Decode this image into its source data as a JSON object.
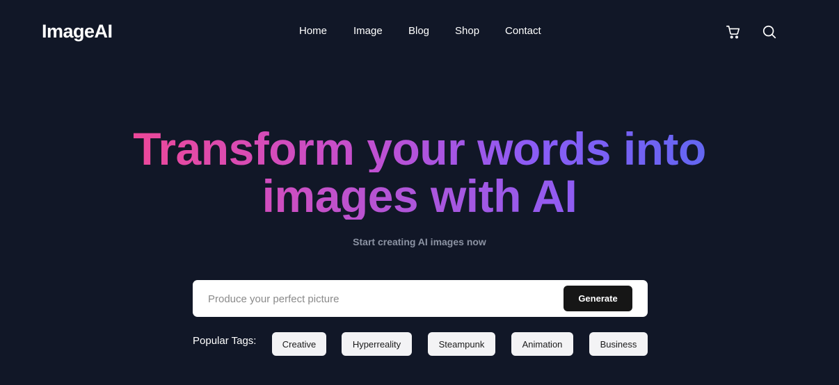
{
  "brand": {
    "name": "ImageAI"
  },
  "nav": {
    "items": [
      {
        "label": "Home"
      },
      {
        "label": "Image"
      },
      {
        "label": "Blog"
      },
      {
        "label": "Shop"
      },
      {
        "label": "Contact"
      }
    ]
  },
  "header_icons": {
    "cart": "cart-icon",
    "search": "search-icon"
  },
  "hero": {
    "title_line1": "Transform your words into",
    "title_line2": "images with AI",
    "subtitle": "Start creating AI images now"
  },
  "prompt": {
    "placeholder": "Produce your perfect picture",
    "value": "",
    "button_label": "Generate"
  },
  "tags": {
    "label": "Popular Tags:",
    "items": [
      {
        "label": "Creative"
      },
      {
        "label": "Hyperreality"
      },
      {
        "label": "Steampunk"
      },
      {
        "label": "Animation"
      },
      {
        "label": "Business"
      }
    ]
  },
  "colors": {
    "background": "#111727",
    "gradient_start": "#ec4899",
    "gradient_end": "#6366f1",
    "button": "#161616",
    "subtitle": "#8c93a3"
  }
}
